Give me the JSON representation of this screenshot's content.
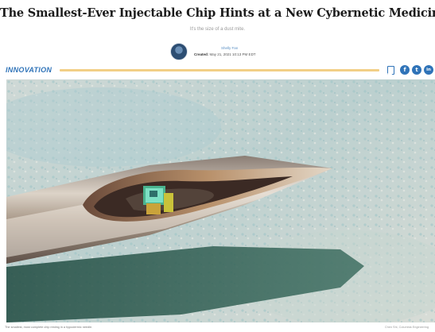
{
  "article": {
    "headline": "The Smallest-Ever Injectable Chip Hints at a New Cybernetic Medicine",
    "subhead": "It's the size of a dust mite.",
    "author": "Shelly Fan",
    "created_label": "Created:",
    "created_date": "May 21, 2021 10:13 PM EDT",
    "section": "INNOVATION",
    "image_caption": "The smallest, most complete chip resting in a hypodermic needle.",
    "image_credit": "Chen Shi, Columbia Engineering"
  },
  "share": {
    "icons": [
      "bookmark-icon",
      "facebook-icon",
      "twitter-icon",
      "linkedin-icon"
    ],
    "glyphs": [
      "f",
      "t",
      "in"
    ]
  },
  "colors": {
    "accent": "#2f73b8",
    "rule": "#f2cf86",
    "headline": "#1b1b1b"
  }
}
